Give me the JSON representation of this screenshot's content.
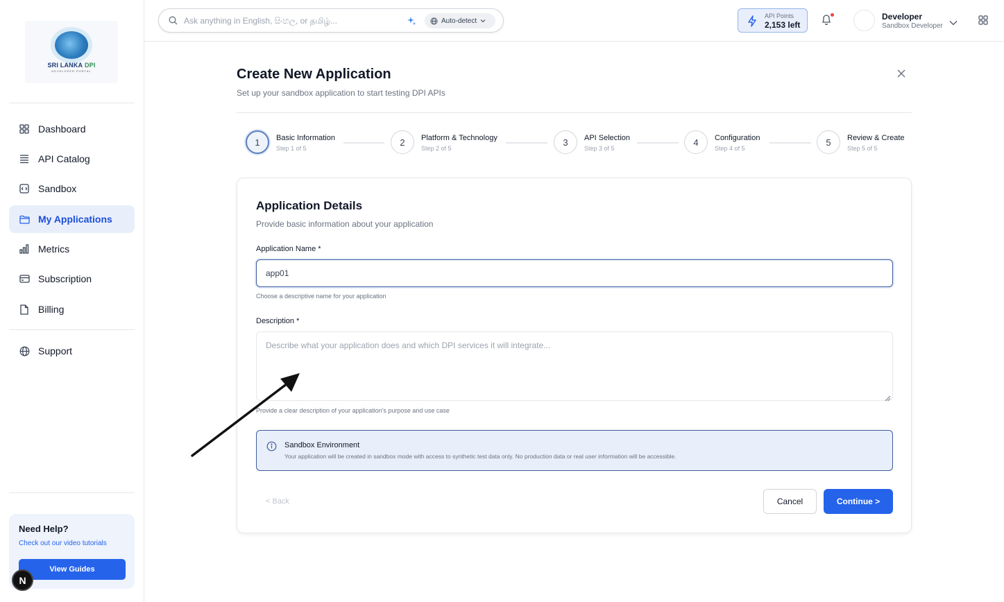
{
  "sidebar": {
    "logo": {
      "text_main": "SRI LANKA",
      "text_accent": "DPI",
      "text_sub": "DEVELOPER PORTAL"
    },
    "items": [
      {
        "label": "Dashboard",
        "icon": "grid-icon"
      },
      {
        "label": "API Catalog",
        "icon": "list-stack-icon"
      },
      {
        "label": "Sandbox",
        "icon": "code-box-icon"
      },
      {
        "label": "My Applications",
        "icon": "folder-icon",
        "active": true
      },
      {
        "label": "Metrics",
        "icon": "bar-chart-icon"
      },
      {
        "label": "Subscription",
        "icon": "credit-card-icon"
      },
      {
        "label": "Billing",
        "icon": "file-icon"
      }
    ],
    "support": {
      "label": "Support",
      "icon": "globe-icon"
    },
    "help": {
      "title": "Need Help?",
      "subtitle": "Check out our video tutorials",
      "button": "View Guides"
    },
    "badge": "N"
  },
  "topbar": {
    "search_placeholder": "Ask anything in English, සිංහල, or தமிழ்...",
    "language": "Auto-detect",
    "points_label": "API Points",
    "points_value": "2,153 left",
    "user_name": "Developer",
    "user_role": "Sandbox Developer"
  },
  "page": {
    "title": "Create New Application",
    "subtitle": "Set up your sandbox application to start testing DPI APIs"
  },
  "steps": [
    {
      "number": "1",
      "title": "Basic Information",
      "sub": "Step 1 of 5",
      "current": true
    },
    {
      "number": "2",
      "title": "Platform & Technology",
      "sub": "Step 2 of 5"
    },
    {
      "number": "3",
      "title": "API Selection",
      "sub": "Step 3 of 5"
    },
    {
      "number": "4",
      "title": "Configuration",
      "sub": "Step 4 of 5"
    },
    {
      "number": "5",
      "title": "Review & Create",
      "sub": "Step 5 of 5"
    }
  ],
  "form": {
    "title": "Application Details",
    "subtitle": "Provide basic information about your application",
    "name_label": "Application Name *",
    "name_value": "app01",
    "name_help": "Choose a descriptive name for your application",
    "desc_label": "Description *",
    "desc_placeholder": "Describe what your application does and which DPI services it will integrate...",
    "desc_help": "Provide a clear description of your application's purpose and use case",
    "info_title": "Sandbox Environment",
    "info_text": "Your application will be created in sandbox mode with access to synthetic test data only. No production data or real user information will be accessible.",
    "back": "< Back",
    "cancel": "Cancel",
    "continue": "Continue >"
  },
  "colors": {
    "accent": "#2563eb",
    "active_bg": "#e8effb",
    "info_bg": "#e9effa"
  }
}
